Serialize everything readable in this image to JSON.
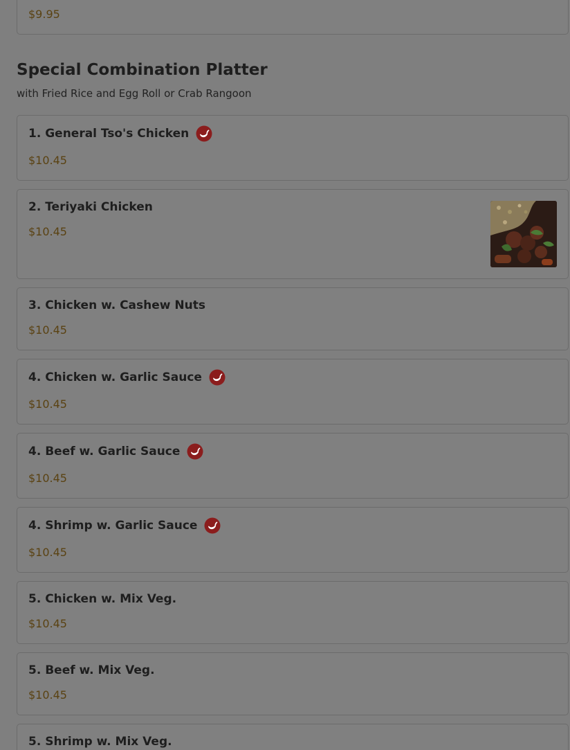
{
  "top_card": {
    "price": "$9.95"
  },
  "section": {
    "title": "Special Combination Platter",
    "subtitle": "with Fried Rice and Egg Roll or Crab Rangoon"
  },
  "items": [
    {
      "name": "1. General Tso's Chicken",
      "price": "$10.45",
      "spicy": true,
      "has_image": false
    },
    {
      "name": "2. Teriyaki Chicken",
      "price": "$10.45",
      "spicy": false,
      "has_image": true
    },
    {
      "name": "3. Chicken w. Cashew Nuts",
      "price": "$10.45",
      "spicy": false,
      "has_image": false
    },
    {
      "name": "4. Chicken w. Garlic Sauce",
      "price": "$10.45",
      "spicy": true,
      "has_image": false
    },
    {
      "name": "4. Beef w. Garlic Sauce",
      "price": "$10.45",
      "spicy": true,
      "has_image": false
    },
    {
      "name": "4. Shrimp w. Garlic Sauce",
      "price": "$10.45",
      "spicy": true,
      "has_image": false
    },
    {
      "name": "5. Chicken w. Mix Veg.",
      "price": "$10.45",
      "spicy": false,
      "has_image": false
    },
    {
      "name": "5. Beef w. Mix Veg.",
      "price": "$10.45",
      "spicy": false,
      "has_image": false
    },
    {
      "name": "5. Shrimp w. Mix Veg.",
      "price": "",
      "spicy": false,
      "has_image": false
    }
  ],
  "colors": {
    "overlay_background": "#7f7f7f",
    "price_text": "#5a4212",
    "spicy_icon": "#8b1d1d"
  },
  "icons": {
    "spicy": "spicy-icon"
  }
}
